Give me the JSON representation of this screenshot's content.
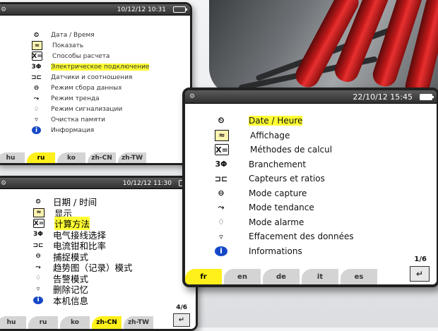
{
  "screens": {
    "ru": {
      "datetime": "10/12/12 10:31",
      "items": [
        {
          "label": "Дата / Время",
          "icon": "clock-icon",
          "glyph": "⏲"
        },
        {
          "label": "Показать",
          "icon": "display-icon",
          "glyph": "≈"
        },
        {
          "label": "Способы расчета",
          "icon": "calc-methods-icon",
          "glyph": "X="
        },
        {
          "label": "Электрическое подключение",
          "icon": "three-phase-icon",
          "glyph": "3Φ"
        },
        {
          "label": "Датчики и соотношения",
          "icon": "sensors-icon",
          "glyph": "⊐⊏"
        },
        {
          "label": "Режим сбора данных",
          "icon": "capture-icon",
          "glyph": "⊖"
        },
        {
          "label": "Режим тренда",
          "icon": "trend-icon",
          "glyph": "⤳"
        },
        {
          "label": "Режим сигнализации",
          "icon": "alarm-bell-icon",
          "glyph": "♢"
        },
        {
          "label": "Очистка памяти",
          "icon": "trash-icon",
          "glyph": "▿"
        },
        {
          "label": "Информация",
          "icon": "info-icon",
          "glyph": "i"
        }
      ],
      "tabs": [
        "hu",
        "ru",
        "ko",
        "zh-CN",
        "zh-TW"
      ],
      "active_tab": "ru"
    },
    "zh": {
      "datetime": "10/12/12 11:30",
      "items": [
        {
          "label": "日期 / 时间",
          "icon": "clock-icon",
          "glyph": "⏲"
        },
        {
          "label": "显示",
          "icon": "display-icon",
          "glyph": "≈"
        },
        {
          "label": "计算方法",
          "icon": "calc-methods-icon",
          "glyph": "X="
        },
        {
          "label": "电气接线选择",
          "icon": "three-phase-icon",
          "glyph": "3Φ"
        },
        {
          "label": "电流钳和比率",
          "icon": "sensors-icon",
          "glyph": "⊐⊏"
        },
        {
          "label": "捕捉模式",
          "icon": "capture-icon",
          "glyph": "⊖"
        },
        {
          "label": "趋势图（记录）模式",
          "icon": "trend-icon",
          "glyph": "⤳"
        },
        {
          "label": "告警模式",
          "icon": "alarm-bell-icon",
          "glyph": "♢"
        },
        {
          "label": "删除记忆",
          "icon": "trash-icon",
          "glyph": "▿"
        },
        {
          "label": "本机信息",
          "icon": "info-icon",
          "glyph": "i"
        }
      ],
      "tabs": [
        "hu",
        "ru",
        "ko",
        "zh-CN",
        "zh-TW"
      ],
      "active_tab": "zh-CN",
      "page": "4/6"
    },
    "fr": {
      "datetime": "22/10/12 15:45",
      "items": [
        {
          "label": "Date / Heure",
          "icon": "clock-icon",
          "glyph": "⏲"
        },
        {
          "label": "Affichage",
          "icon": "display-icon",
          "glyph": "≈"
        },
        {
          "label": "Méthodes de calcul",
          "icon": "calc-methods-icon",
          "glyph": "X="
        },
        {
          "label": "Branchement",
          "icon": "three-phase-icon",
          "glyph": "3Φ"
        },
        {
          "label": "Capteurs et ratios",
          "icon": "sensors-icon",
          "glyph": "⊐⊏"
        },
        {
          "label": "Mode capture",
          "icon": "capture-icon",
          "glyph": "⊖"
        },
        {
          "label": "Mode tendance",
          "icon": "trend-icon",
          "glyph": "⤳"
        },
        {
          "label": "Mode alarme",
          "icon": "alarm-bell-icon",
          "glyph": "♢"
        },
        {
          "label": "Effacement des données",
          "icon": "trash-icon",
          "glyph": "▿"
        },
        {
          "label": "Informations",
          "icon": "info-icon",
          "glyph": "i"
        }
      ],
      "tabs": [
        "fr",
        "en",
        "de",
        "it",
        "es"
      ],
      "active_tab": "fr",
      "page": "1/6"
    }
  },
  "colors": {
    "highlight": "#ffff33",
    "active_tab": "#ffef1a",
    "info_blue": "#1548c8",
    "titlebar": "#3a3a3a"
  },
  "highlighted": {
    "ru": 3,
    "zh": 2,
    "fr": 0
  }
}
